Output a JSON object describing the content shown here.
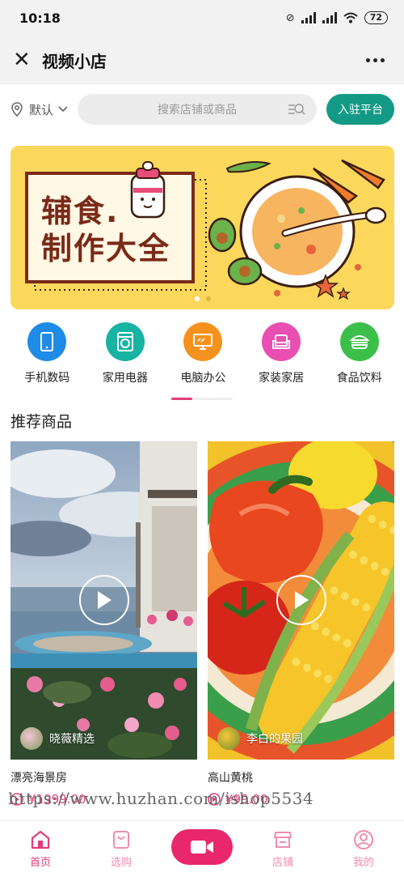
{
  "status_bar": {
    "time": "10:18",
    "battery": "72"
  },
  "header": {
    "title": "视频小店"
  },
  "search_row": {
    "location": "默认",
    "search_placeholder": "搜索店铺或商品",
    "join_button": "入驻平台"
  },
  "banner": {
    "line1": "辅食.",
    "line2": "制作大全",
    "active_page": 1,
    "page_count": 2
  },
  "categories": [
    {
      "label": "手机数码",
      "icon": "phone-icon",
      "color": "#1e8be6"
    },
    {
      "label": "家用电器",
      "icon": "washing-machine-icon",
      "color": "#17b3a3"
    },
    {
      "label": "电脑办公",
      "icon": "monitor-icon",
      "color": "#f5921e"
    },
    {
      "label": "家装家居",
      "icon": "sofa-icon",
      "color": "#e84fb0"
    },
    {
      "label": "食品饮料",
      "icon": "burger-icon",
      "color": "#3cbf4a"
    }
  ],
  "section": {
    "title": "推荐商品"
  },
  "products": [
    {
      "name": "漂亮海景房",
      "shop": "晓薇精选",
      "price": "¥1999.00"
    },
    {
      "name": "高山黄桃",
      "shop": "李白的果园",
      "price": "¥99.00"
    }
  ],
  "watermark": "https://www.huzhan.com/ishop5534",
  "tabbar": [
    {
      "label": "首页",
      "icon": "home-icon",
      "active": true
    },
    {
      "label": "选购",
      "icon": "shopping-bag-icon",
      "active": false
    },
    {
      "label": "",
      "icon": "video-camera-icon",
      "active": false
    },
    {
      "label": "店铺",
      "icon": "store-icon",
      "active": false
    },
    {
      "label": "我的",
      "icon": "user-icon",
      "active": false
    }
  ],
  "colors": {
    "accent": "#e8276c",
    "join_button": "#139a86",
    "banner_bg": "#fbd85c"
  }
}
